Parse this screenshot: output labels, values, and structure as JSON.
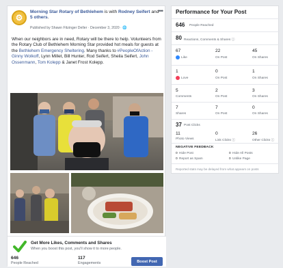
{
  "post": {
    "page_name": "Morning Star Rotary of Bethlehem",
    "with_text": "is with",
    "tagged_person": "Rodney Seifert",
    "and_text": "and",
    "others": "5 others",
    "byline": "Published by Shawn Fitzinger Deller · December 3, 2020 ·",
    "body_intro": "When our neighbors are in need, Rotary will be there to help. Volunteers from the Rotary Club of Bethlehem Morning Star provided hot meals for guests at the",
    "body_link1": "Bethlehem Emergency Sheltering",
    "body_mid": ". Many thanks to",
    "body_link2": "#PeopleOfAction - Ginny Wolkoff",
    "body_names": ", Lynn Millet, Bill Hunter, Rod Seifert, Sheila Seifert,",
    "body_link3": "John Ossenmann",
    "body_comma": ",",
    "body_link4": "Tom Kolepp",
    "body_amp": "& Janet Frost Kolepp."
  },
  "promo": {
    "title": "Get More Likes, Comments and Shares",
    "subtitle": "When you boost this post, you'll show it to more people."
  },
  "footer": {
    "reached_value": "646",
    "reached_label": "People Reached",
    "engagements_value": "117",
    "engagements_label": "Engagements",
    "boost_label": "Boost Post"
  },
  "performance": {
    "title": "Performance for Your Post",
    "people_reached_value": "646",
    "people_reached_label": "People Reached",
    "reactions_value": "80",
    "reactions_label": "Reactions, Comments & Shares ⓘ",
    "rows": [
      {
        "c1_num": "67",
        "c1_lbl": "Like",
        "c2_num": "22",
        "c2_lbl": "On Post",
        "c3_num": "45",
        "c3_lbl": "On Shares"
      },
      {
        "c1_num": "1",
        "c1_lbl": "Love",
        "c2_num": "0",
        "c2_lbl": "On Post",
        "c3_num": "1",
        "c3_lbl": "On Shares"
      },
      {
        "c1_num": "5",
        "c1_lbl": "Comments",
        "c2_num": "2",
        "c2_lbl": "On Post",
        "c3_num": "3",
        "c3_lbl": "On Shares"
      },
      {
        "c1_num": "7",
        "c1_lbl": "Shares",
        "c2_num": "7",
        "c2_lbl": "On Post",
        "c3_num": "0",
        "c3_lbl": "On Shares"
      }
    ],
    "post_clicks_value": "37",
    "post_clicks_label": "Post Clicks",
    "clicks": [
      {
        "num": "11",
        "lbl": "Photo Views"
      },
      {
        "num": "0",
        "lbl": "Link Clicks ⓘ"
      },
      {
        "num": "26",
        "lbl": "Other Clicks ⓘ"
      }
    ],
    "negative_title": "NEGATIVE FEEDBACK",
    "negative": [
      {
        "num": "0",
        "lbl": "Hide Post"
      },
      {
        "num": "0",
        "lbl": "Hide All Posts"
      },
      {
        "num": "0",
        "lbl": "Report as Spam"
      },
      {
        "num": "0",
        "lbl": "Unlike Page"
      }
    ],
    "note": "Reported stats may be delayed from what appears on posts"
  },
  "colors": {
    "link": "#385898",
    "boost": "#4267b2",
    "like": "#2d88ff",
    "love": "#f33e58",
    "check": "#42b72a"
  },
  "icons": [
    "rotary-logo-icon",
    "more-options-icon",
    "globe-icon",
    "check-icon",
    "like-icon",
    "love-icon"
  ]
}
